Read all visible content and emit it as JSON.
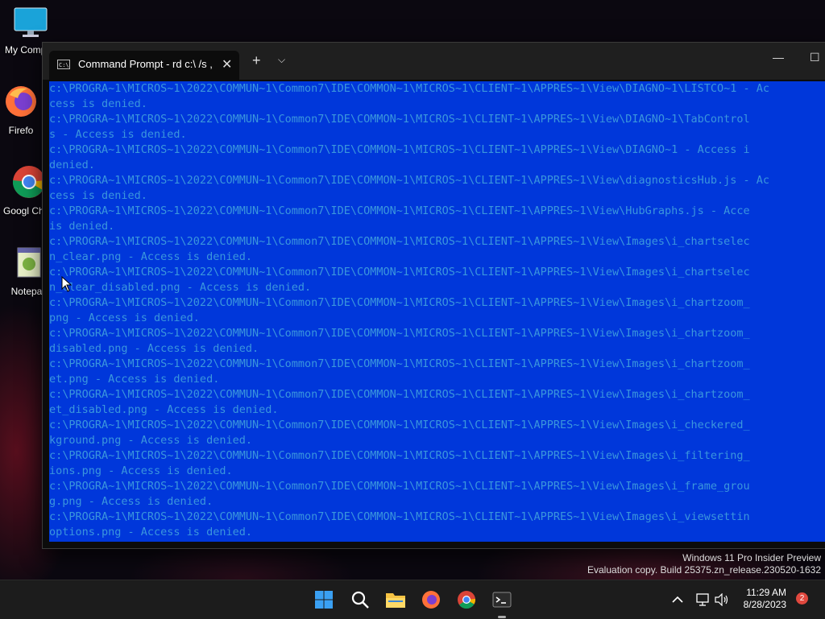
{
  "desktop": {
    "icons": [
      {
        "label": "My Comp",
        "icon": "monitor-icon"
      },
      {
        "label": "Firefo",
        "icon": "firefox-icon"
      },
      {
        "label": "Googl Chrom",
        "icon": "chrome-icon"
      },
      {
        "label": "Notepac",
        "icon": "notepad-icon"
      }
    ]
  },
  "window": {
    "tab_title": "Command Prompt - rd  c:\\ /s ,",
    "new_tab_glyph": "+",
    "dropdown_glyph": "⌵",
    "close_tab_glyph": "✕",
    "minimize_glyph": "—",
    "maximize_glyph": "☐"
  },
  "console": {
    "lines": [
      "c:\\PROGRA~1\\MICROS~1\\2022\\COMMUN~1\\Common7\\IDE\\COMMON~1\\MICROS~1\\CLIENT~1\\APPRES~1\\View\\DIAGNO~1\\LISTCO~1 - Ac",
      "cess is denied.",
      "c:\\PROGRA~1\\MICROS~1\\2022\\COMMUN~1\\Common7\\IDE\\COMMON~1\\MICROS~1\\CLIENT~1\\APPRES~1\\View\\DIAGNO~1\\TabControl",
      "s - Access is denied.",
      "c:\\PROGRA~1\\MICROS~1\\2022\\COMMUN~1\\Common7\\IDE\\COMMON~1\\MICROS~1\\CLIENT~1\\APPRES~1\\View\\DIAGNO~1 - Access i",
      "denied.",
      "c:\\PROGRA~1\\MICROS~1\\2022\\COMMUN~1\\Common7\\IDE\\COMMON~1\\MICROS~1\\CLIENT~1\\APPRES~1\\View\\diagnosticsHub.js - Ac",
      "cess is denied.",
      "c:\\PROGRA~1\\MICROS~1\\2022\\COMMUN~1\\Common7\\IDE\\COMMON~1\\MICROS~1\\CLIENT~1\\APPRES~1\\View\\HubGraphs.js - Acce",
      "is denied.",
      "c:\\PROGRA~1\\MICROS~1\\2022\\COMMUN~1\\Common7\\IDE\\COMMON~1\\MICROS~1\\CLIENT~1\\APPRES~1\\View\\Images\\i_chartselec",
      "n_clear.png - Access is denied.",
      "c:\\PROGRA~1\\MICROS~1\\2022\\COMMUN~1\\Common7\\IDE\\COMMON~1\\MICROS~1\\CLIENT~1\\APPRES~1\\View\\Images\\i_chartselec",
      "n_clear_disabled.png - Access is denied.",
      "c:\\PROGRA~1\\MICROS~1\\2022\\COMMUN~1\\Common7\\IDE\\COMMON~1\\MICROS~1\\CLIENT~1\\APPRES~1\\View\\Images\\i_chartzoom_",
      "png - Access is denied.",
      "c:\\PROGRA~1\\MICROS~1\\2022\\COMMUN~1\\Common7\\IDE\\COMMON~1\\MICROS~1\\CLIENT~1\\APPRES~1\\View\\Images\\i_chartzoom_",
      "disabled.png - Access is denied.",
      "c:\\PROGRA~1\\MICROS~1\\2022\\COMMUN~1\\Common7\\IDE\\COMMON~1\\MICROS~1\\CLIENT~1\\APPRES~1\\View\\Images\\i_chartzoom_",
      "et.png - Access is denied.",
      "c:\\PROGRA~1\\MICROS~1\\2022\\COMMUN~1\\Common7\\IDE\\COMMON~1\\MICROS~1\\CLIENT~1\\APPRES~1\\View\\Images\\i_chartzoom_",
      "et_disabled.png - Access is denied.",
      "c:\\PROGRA~1\\MICROS~1\\2022\\COMMUN~1\\Common7\\IDE\\COMMON~1\\MICROS~1\\CLIENT~1\\APPRES~1\\View\\Images\\i_checkered_",
      "kground.png - Access is denied.",
      "c:\\PROGRA~1\\MICROS~1\\2022\\COMMUN~1\\Common7\\IDE\\COMMON~1\\MICROS~1\\CLIENT~1\\APPRES~1\\View\\Images\\i_filtering_",
      "ions.png - Access is denied.",
      "c:\\PROGRA~1\\MICROS~1\\2022\\COMMUN~1\\Common7\\IDE\\COMMON~1\\MICROS~1\\CLIENT~1\\APPRES~1\\View\\Images\\i_frame_grou",
      "g.png - Access is denied.",
      "c:\\PROGRA~1\\MICROS~1\\2022\\COMMUN~1\\Common7\\IDE\\COMMON~1\\MICROS~1\\CLIENT~1\\APPRES~1\\View\\Images\\i_viewsettin",
      "options.png - Access is denied."
    ]
  },
  "watermark": {
    "line1": "Windows 11 Pro Insider Preview",
    "line2": "Evaluation copy. Build 25375.zn_release.230520-1632"
  },
  "taskbar": {
    "items": [
      "start-icon",
      "search-icon",
      "file-explorer-icon",
      "firefox-icon",
      "chrome-icon",
      "terminal-icon"
    ],
    "time": "11:29 AM",
    "date": "8/28/2023",
    "notification_count": "2"
  },
  "colors": {
    "selection": "#0037da",
    "console_text": "#3a96dd",
    "taskbar": "#1c1c1c"
  }
}
